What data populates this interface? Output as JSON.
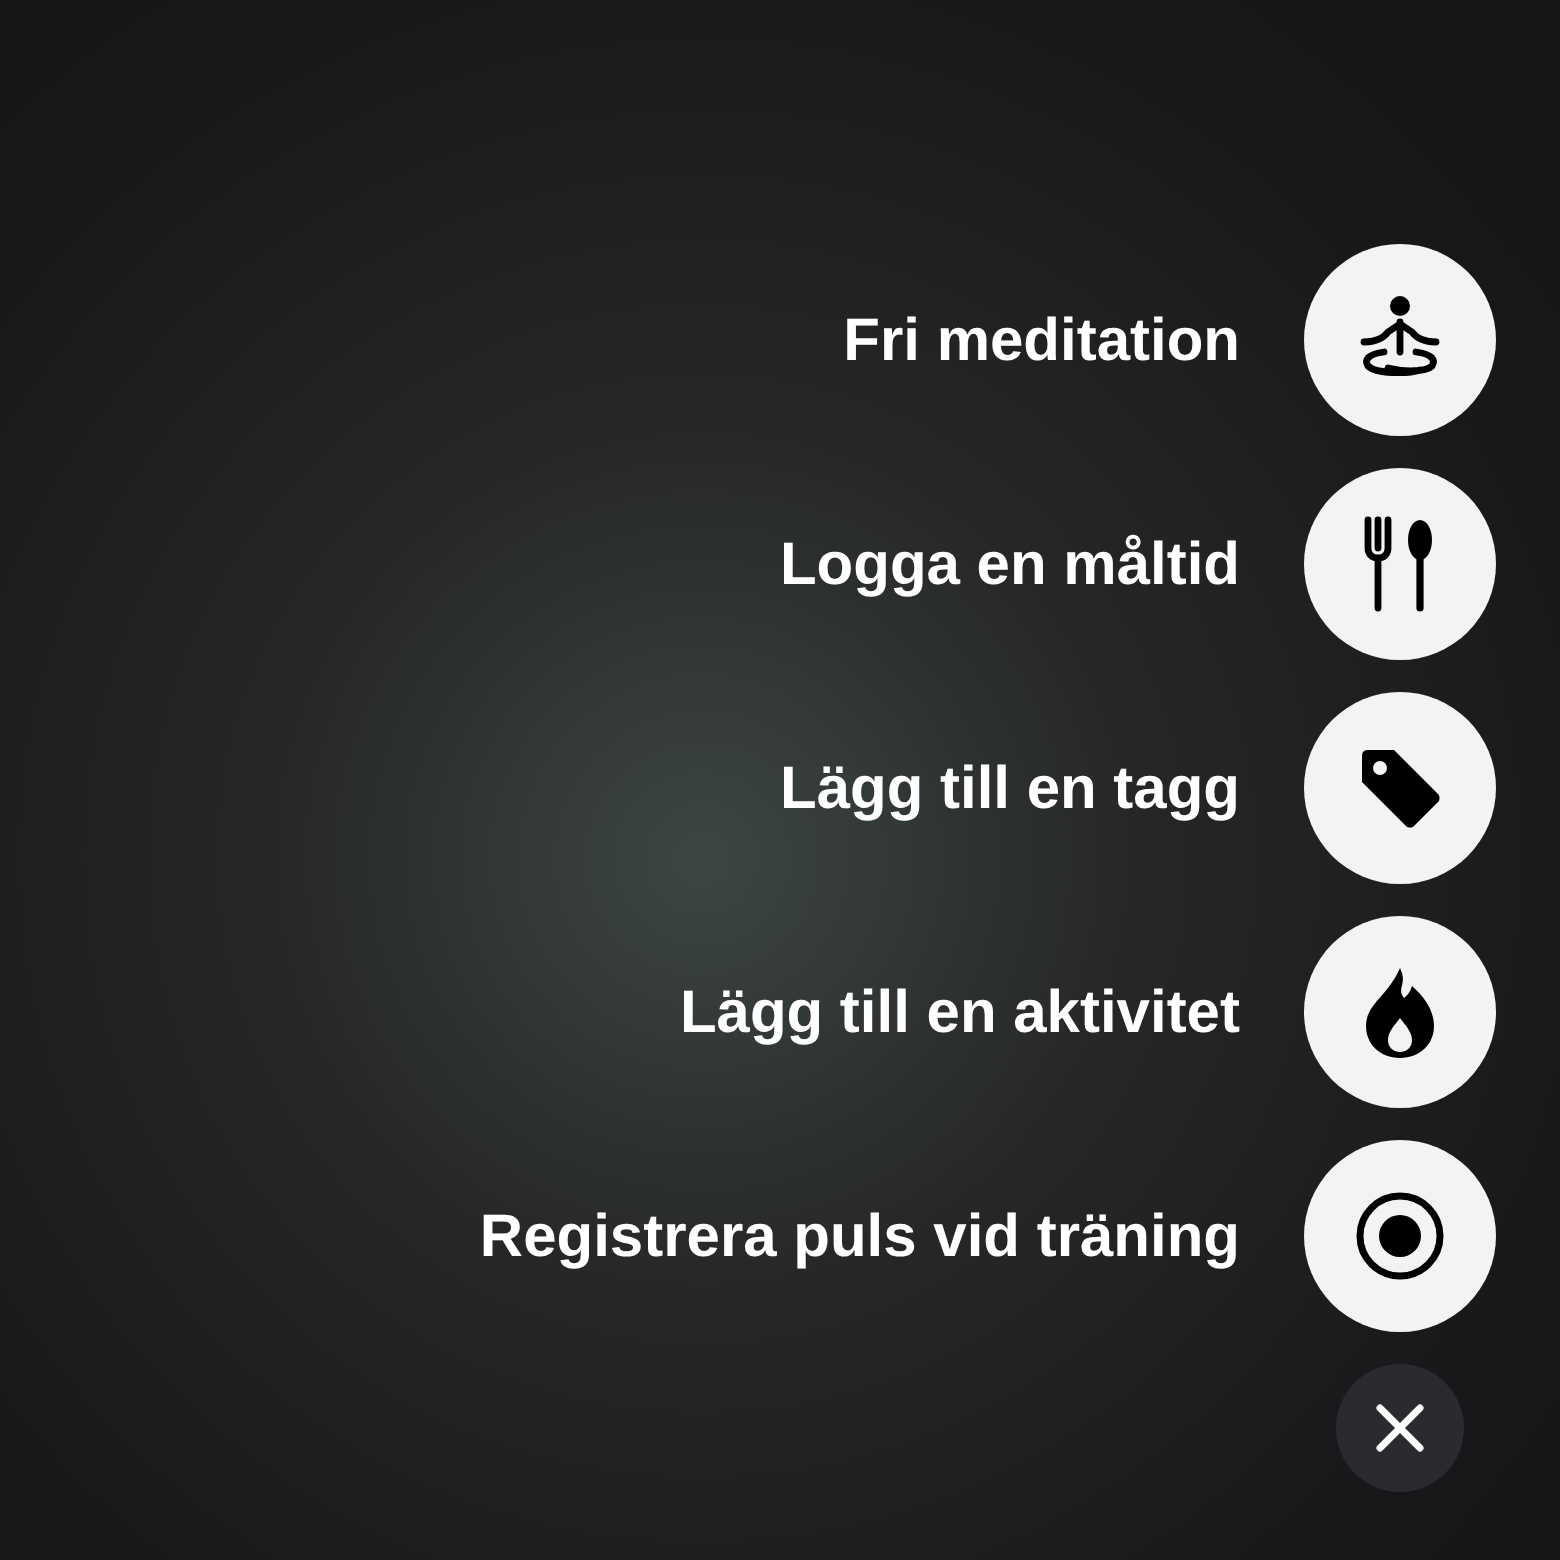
{
  "actions": [
    {
      "label": "Fri meditation",
      "kind": "meditation"
    },
    {
      "label": "Logga en måltid",
      "kind": "meal"
    },
    {
      "label": "Lägg till en tagg",
      "kind": "tag"
    },
    {
      "label": "Lägg till en aktivitet",
      "kind": "activity"
    },
    {
      "label": "Registrera puls vid träning",
      "kind": "record"
    }
  ]
}
